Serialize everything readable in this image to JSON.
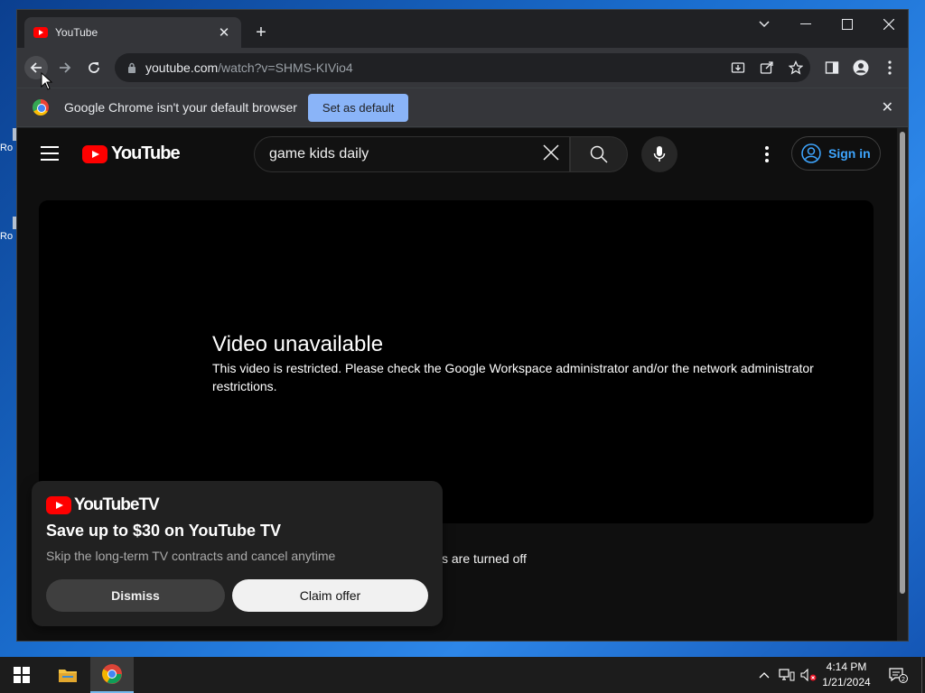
{
  "desktop": {
    "icons": [
      {
        "label": "Ro"
      },
      {
        "label": "Ro"
      }
    ]
  },
  "browser": {
    "tab": {
      "title": "YouTube"
    },
    "url": {
      "host": "youtube.com",
      "path": "/watch?v=SHMS-KIVio4"
    },
    "infobar": {
      "message": "Google Chrome isn't your default browser",
      "button_label": "Set as default"
    }
  },
  "youtube": {
    "logo_text": "YouTube",
    "search": {
      "query": "game kids daily"
    },
    "sign_in_label": "Sign in",
    "player": {
      "title": "Video unavailable",
      "message": "This video is restricted. Please check the Google Workspace administrator and/or the network administrator restrictions."
    },
    "comments_status": "s are turned off",
    "promo": {
      "logo_text": "YouTubeTV",
      "headline": "Save up to $30 on YouTube TV",
      "subtext": "Skip the long-term TV contracts and cancel anytime",
      "dismiss_label": "Dismiss",
      "claim_label": "Claim offer"
    }
  },
  "taskbar": {
    "time": "4:14 PM",
    "date": "1/21/2024",
    "notification_count": "2"
  },
  "colors": {
    "youtube_red": "#ff0000",
    "link_blue": "#3ea6ff",
    "chrome_accent": "#8ab4f8"
  }
}
